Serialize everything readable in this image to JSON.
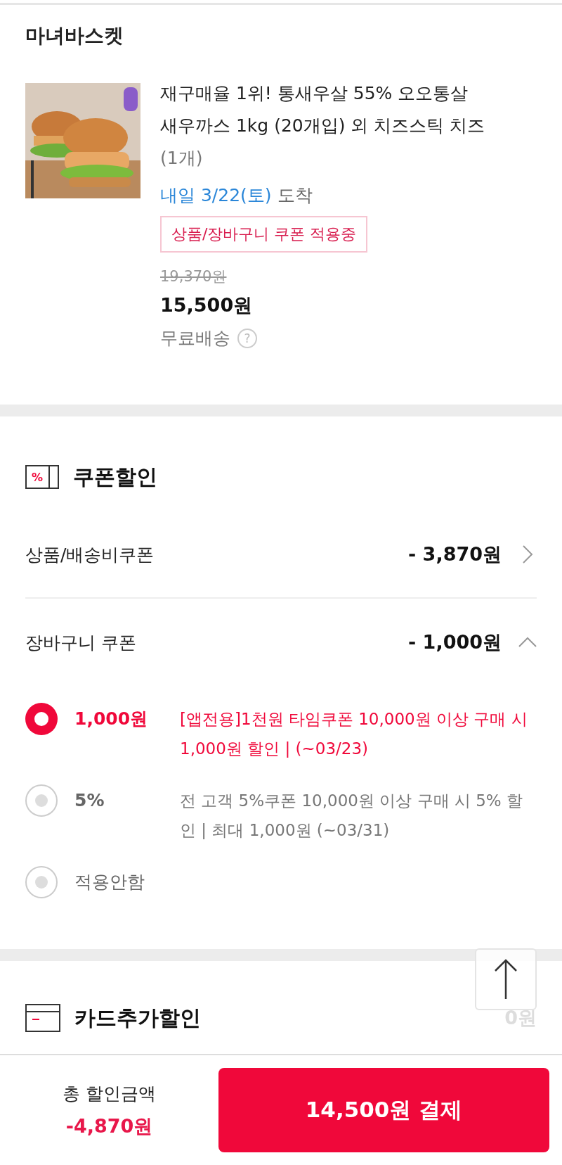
{
  "store": {
    "name": "마녀바스켓"
  },
  "product": {
    "kind": "picture",
    "title": "재구매율 1위! 통새우살 55% 오오통살 새우까스 1kg (20개입) 외 치즈스틱 치즈",
    "quantity": "(1개)",
    "delivery_date": "내일 3/22(토)",
    "delivery_suffix": "도착",
    "coupon_tag": "상품/장바구니 쿠폰 적용중",
    "original_price": "19,370원",
    "price": "15,500원",
    "shipping": "무료배송",
    "help_icon": "?"
  },
  "coupon_section": {
    "icon_symbol": "%",
    "title": "쿠폰할인",
    "rows": [
      {
        "label": "상품/배송비쿠폰",
        "amount": "- 3,870원",
        "expanded": false
      },
      {
        "label": "장바구니 쿠폰",
        "amount": "- 1,000원",
        "expanded": true
      }
    ],
    "options": [
      {
        "label": "1,000원",
        "description": "[앱전용]1천원 타임쿠폰 10,000원 이상 구매 시 1,000원 할인 | (~03/23)",
        "selected": true
      },
      {
        "label": "5%",
        "description": "전 고객 5%쿠폰 10,000원 이상 구매 시 5% 할인 | 최대 1,000원 (~03/31)",
        "selected": false
      },
      {
        "label": "적용안함",
        "selected": false
      }
    ]
  },
  "card_section": {
    "title": "카드추가할인",
    "amount": "0원"
  },
  "bottom_bar": {
    "total_label": "총 할인금액",
    "total_amount": "-4,870원",
    "pay_button": "14,500원 결제"
  }
}
